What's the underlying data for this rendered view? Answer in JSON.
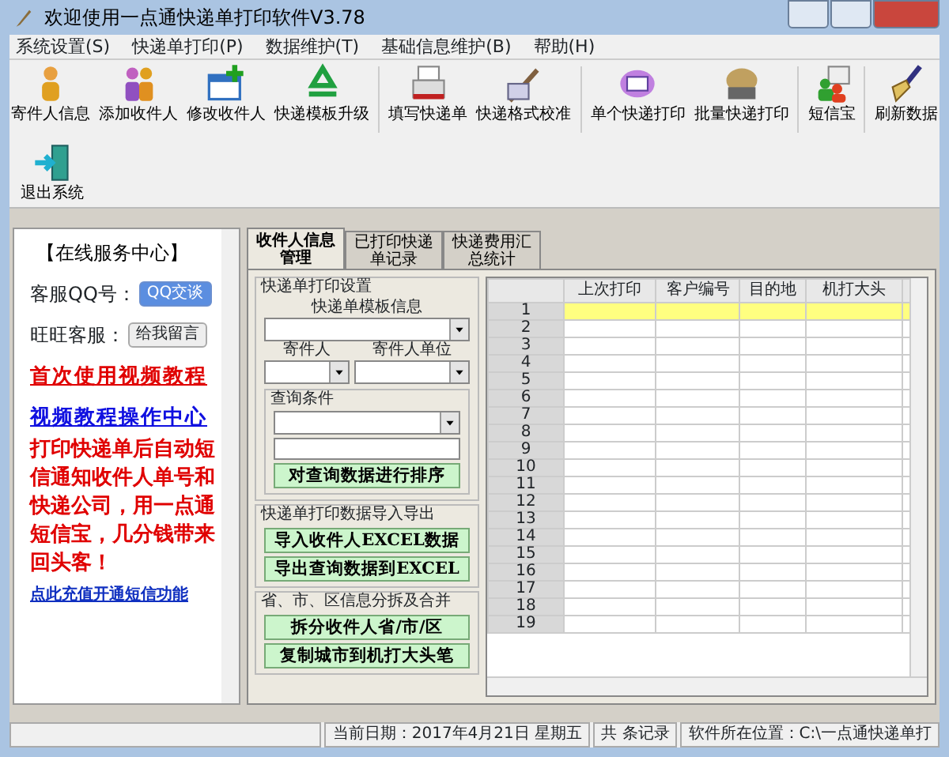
{
  "window": {
    "title": "欢迎使用一点通快递单打印软件V3.78"
  },
  "menu": [
    "系统设置(S)",
    "快递单打印(P)",
    "数据维护(T)",
    "基础信息维护(B)",
    "帮助(H)"
  ],
  "toolbar": [
    {
      "label": "寄件人信息"
    },
    {
      "label": "添加收件人"
    },
    {
      "label": "修改收件人"
    },
    {
      "label": "快递模板升级"
    },
    {
      "label": "填写快递单"
    },
    {
      "label": "快递格式校准"
    },
    {
      "label": "单个快递打印"
    },
    {
      "label": "批量快递打印"
    },
    {
      "label": "短信宝"
    },
    {
      "label": "刷新数据"
    },
    {
      "label": "退出系统"
    }
  ],
  "service_panel": {
    "title": "【在线服务中心】",
    "qq_label": "客服QQ号：",
    "qq_button": "QQ交谈",
    "wangwang_label": "旺旺客服：",
    "wangwang_button": "给我留言",
    "video_link": "首次使用视频教程",
    "center_link": "视频教程操作中心",
    "promo": "打印快递单后自动短信通知收件人单号和快递公司，用一点通短信宝，几分钱带来回头客！",
    "recharge_link": "点此充值开通短信功能"
  },
  "tabs": [
    {
      "label": "收件人信息管理",
      "selected": true
    },
    {
      "label": "已打印快递单记录",
      "selected": false
    },
    {
      "label": "快递费用汇总统计",
      "selected": false
    }
  ],
  "print_settings": {
    "title": "快递单打印设置",
    "template_label": "快递单模板信息",
    "sender_label": "寄件人",
    "sender_unit_label": "寄件人单位",
    "query_title": "查询条件",
    "sort_button": "对查询数据进行排序"
  },
  "import_export": {
    "title": "快递单打印数据导入导出",
    "buttons": [
      "导入收件人EXCEL数据",
      "导出查询数据到EXCEL"
    ]
  },
  "region": {
    "title": "省、市、区信息分拆及合并",
    "buttons": [
      "拆分收件人省/市/区",
      "复制城市到机打大头笔"
    ]
  },
  "table": {
    "columns": [
      "上次打印",
      "客户编号",
      "目的地",
      "机打大头"
    ],
    "rows": [
      {
        "number": "1",
        "selected": true
      },
      {
        "number": "2",
        "selected": false
      },
      {
        "number": "3",
        "selected": false
      },
      {
        "number": "4",
        "selected": false
      },
      {
        "number": "5",
        "selected": false
      },
      {
        "number": "6",
        "selected": false
      },
      {
        "number": "7",
        "selected": false
      },
      {
        "number": "8",
        "selected": false
      },
      {
        "number": "9",
        "selected": false
      },
      {
        "number": "10",
        "selected": false
      },
      {
        "number": "11",
        "selected": false
      },
      {
        "number": "12",
        "selected": false
      },
      {
        "number": "13",
        "selected": false
      },
      {
        "number": "14",
        "selected": false
      },
      {
        "number": "15",
        "selected": false
      },
      {
        "number": "16",
        "selected": false
      },
      {
        "number": "17",
        "selected": false
      },
      {
        "number": "18",
        "selected": false
      },
      {
        "number": "19",
        "selected": false
      }
    ]
  },
  "status_bar": [
    "当前日期：2017年4月21日  星期五",
    "共   条记录",
    "软件所在位置：C:\\一点通快递单打"
  ]
}
